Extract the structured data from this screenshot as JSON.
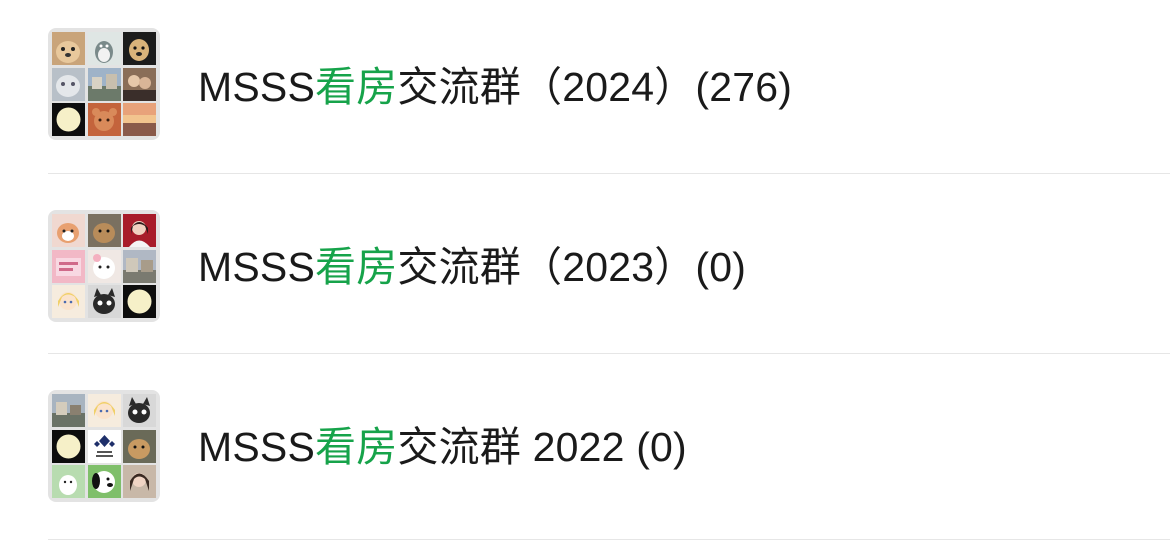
{
  "chats": [
    {
      "title_prefix": "MSSS",
      "title_highlight": "看房",
      "title_suffix": "交流群（2024）(276)",
      "avatar_tiles": [
        "dog-photo",
        "totoro-photo",
        "dog-photo",
        "cat-photo",
        "street-photo",
        "people-photo",
        "moon-photo",
        "bear-photo",
        "sunset-photo"
      ]
    },
    {
      "title_prefix": "MSSS",
      "title_highlight": "看房",
      "title_suffix": "交流群（2023）(0)",
      "avatar_tiles": [
        "cat-photo",
        "dog-photo",
        "portrait-photo",
        "pink-card-photo",
        "white-dog-photo",
        "street-photo",
        "anime-girl-photo",
        "black-cat-photo",
        "moon-photo"
      ]
    },
    {
      "title_prefix": "MSSS",
      "title_highlight": "看房",
      "title_suffix": "交流群 2022 (0)",
      "avatar_tiles": [
        "street-photo",
        "anime-girl-photo",
        "black-cat-photo",
        "moon-photo",
        "logo-photo",
        "dog-photo",
        "cartoon-photo",
        "snoopy-photo",
        "portrait-photo"
      ]
    }
  ],
  "colors": {
    "highlight": "#16a34a",
    "text": "#1a1a1a",
    "divider": "#e6e6e6"
  }
}
